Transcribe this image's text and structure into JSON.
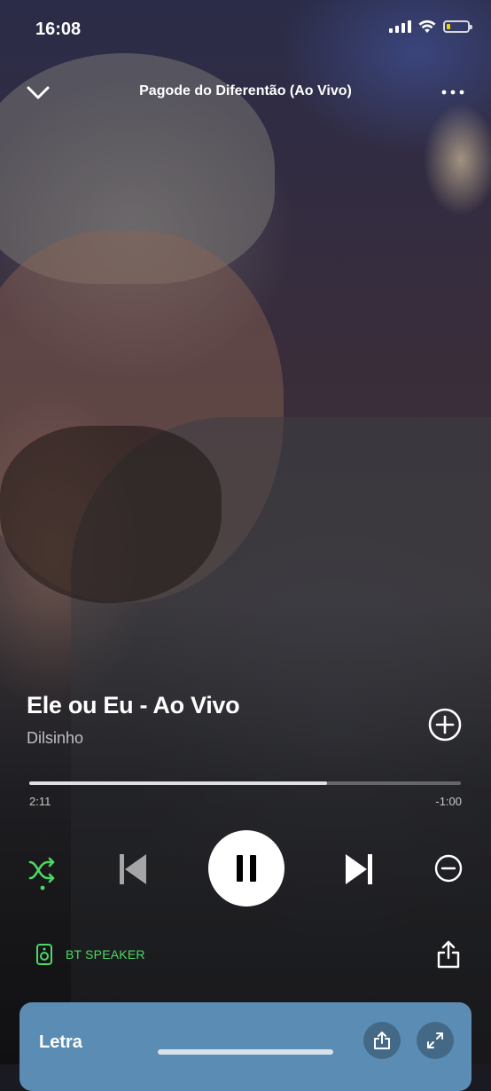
{
  "status_bar": {
    "time": "16:08",
    "battery_level": 0.2,
    "battery_color": "#f5d000"
  },
  "header": {
    "title": "Pagode do Diferentão (Ao Vivo)",
    "back_icon": "chevron-down-icon",
    "more_icon": "more-icon"
  },
  "track": {
    "title": "Ele ou Eu - Ao Vivo",
    "artist": "Dilsinho"
  },
  "progress": {
    "elapsed": "2:11",
    "remaining": "-1:00",
    "fraction": 0.69
  },
  "controls": {
    "shuffle_icon": "shuffle-icon",
    "shuffle_active": true,
    "previous_icon": "skip-previous-icon",
    "play_state": "playing",
    "pause_icon": "pause-icon",
    "next_icon": "skip-next-icon",
    "block_icon": "remove-circle-icon"
  },
  "device": {
    "label": "BT SPEAKER",
    "icon": "speaker-icon",
    "accent": "#4cd964"
  },
  "lyrics": {
    "label": "Letra",
    "background": "#5b8db4"
  },
  "colors": {
    "accent_green": "#4cd964"
  }
}
